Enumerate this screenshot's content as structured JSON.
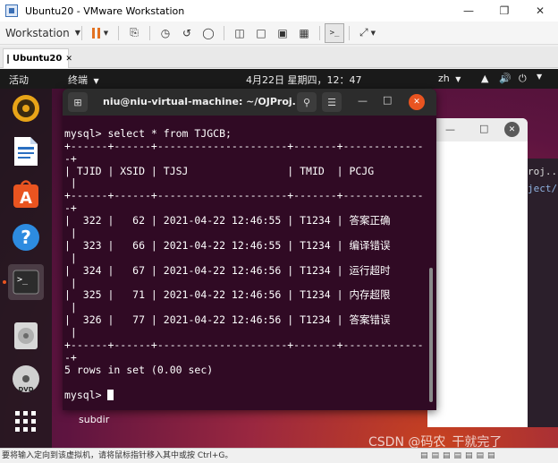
{
  "vmware": {
    "title": "Ubuntu20 - VMware Workstation",
    "workstation_menu": "Workstation",
    "tab_label": "Ubuntu20",
    "status": "要将输入定向到该虚拟机，请将鼠标指针移入其中或按 Ctrl+G。"
  },
  "ubuntu": {
    "activities": "活动",
    "app_menu": "终端",
    "clock": "4月22日 星期四，12：47",
    "lang": "zh",
    "desktop_label": "subdir",
    "watermark": "CSDN @码农_干就完了"
  },
  "terminal": {
    "title": "niu@niu-virtual-machine: ~/OJProj...",
    "lines": [
      "",
      "mysql> select * from TJGCB;",
      "+------+------+---------------------+-------+-------------",
      "-+",
      "| TJID | XSID | TJSJ                | TMID  | PCJG        ",
      " |",
      "+------+------+---------------------+-------+-------------",
      "-+",
      "|  322 |   62 | 2021-04-22 12:46:55 | T1234 | 答案正确    ",
      " |",
      "|  323 |   66 | 2021-04-22 12:46:55 | T1234 | 编译错误    ",
      " |",
      "|  324 |   67 | 2021-04-22 12:46:56 | T1234 | 运行超时    ",
      " |",
      "|  325 |   71 | 2021-04-22 12:46:56 | T1234 | 内存超限    ",
      " |",
      "|  326 |   77 | 2021-04-22 12:46:56 | T1234 | 答案错误    ",
      " |",
      "+------+------+---------------------+-------+-------------",
      "-+",
      "5 rows in set (0.00 sec)",
      "",
      "mysql> "
    ]
  },
  "bg_window_edge_text": [
    "roj...",
    "ject/"
  ],
  "colors": {
    "terminal_bg": "#300a24",
    "ubuntu_accent": "#e95420"
  }
}
